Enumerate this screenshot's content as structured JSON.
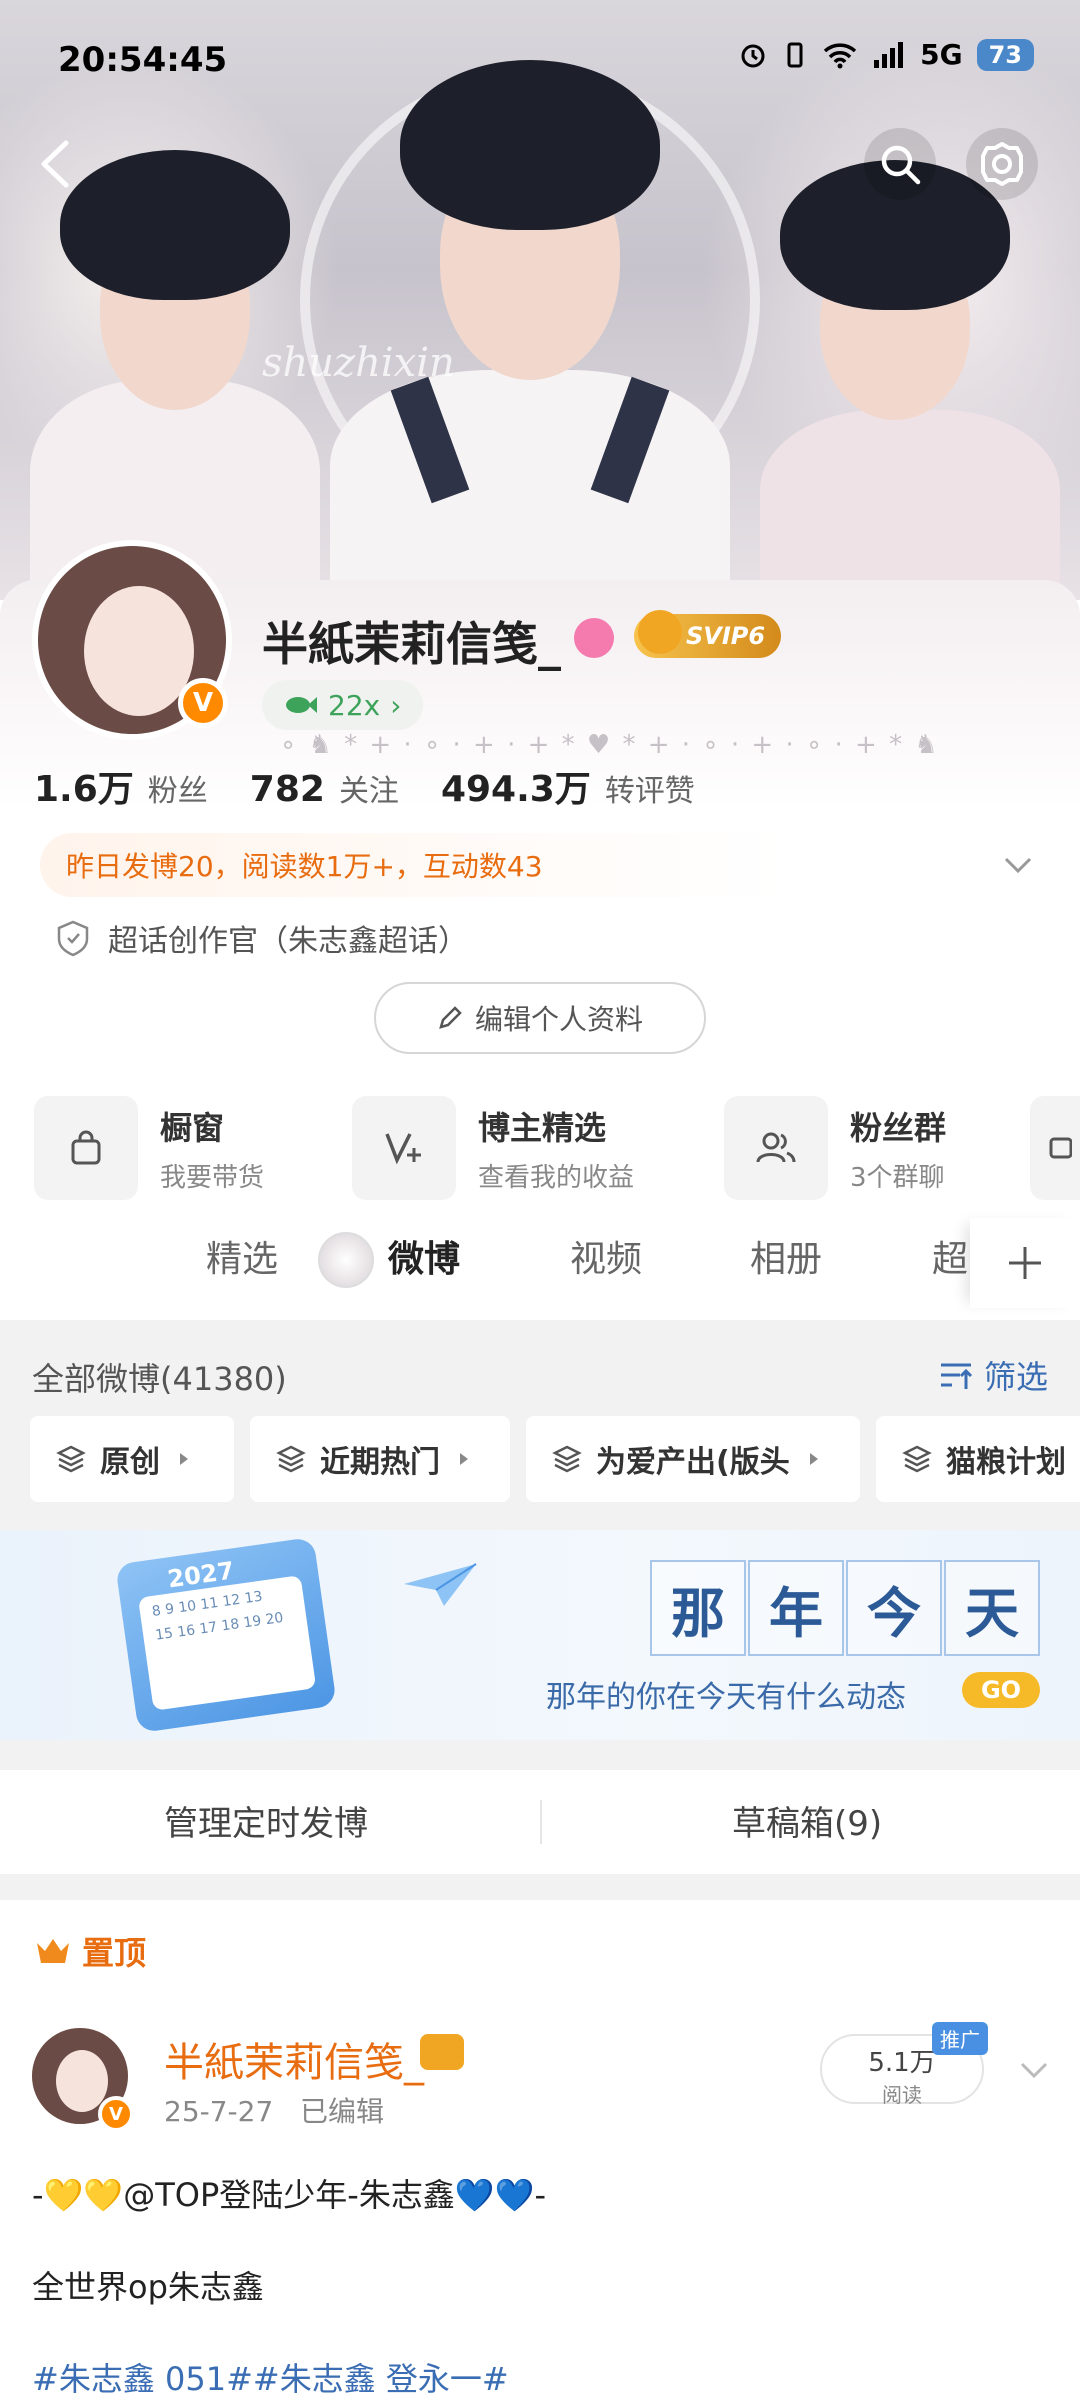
{
  "status_bar": {
    "time": "20:54:45",
    "network": "5G",
    "battery": "73"
  },
  "banner": {
    "watermark": "shuzhixin"
  },
  "profile": {
    "name": "半紙茉莉信笺_",
    "svip": "SVIP6",
    "fish_count": "22x",
    "stats": [
      {
        "value": "1.6万",
        "label": "粉丝"
      },
      {
        "value": "782",
        "label": "关注"
      },
      {
        "value": "494.3万",
        "label": "转评赞"
      }
    ],
    "yesterday": "昨日发博20，阅读数1万+，互动数43",
    "chaohua": "超话创作官（朱志鑫超话）",
    "edit_label": "编辑个人资料"
  },
  "features": [
    {
      "title": "橱窗",
      "sub": "我要带货",
      "icon": "shopping-bag-icon"
    },
    {
      "title": "博主精选",
      "sub": "查看我的收益",
      "icon": "v-plus-icon"
    },
    {
      "title": "粉丝群",
      "sub": "3个群聊",
      "icon": "group-icon"
    }
  ],
  "tabs": [
    "精选",
    "微博",
    "视频",
    "相册",
    "超"
  ],
  "weibo": {
    "all_label": "全部微博(41380)",
    "filter_label": "筛选",
    "chips": [
      "原创",
      "近期热门",
      "为爱产出(版头",
      "猫粮计划"
    ]
  },
  "promo": {
    "year": "2027",
    "title_chars": [
      "那",
      "年",
      "今",
      "天"
    ],
    "subtitle": "那年的你在今天有什么动态",
    "go": "GO"
  },
  "manage": {
    "scheduled": "管理定时发博",
    "drafts": "草稿箱(9)"
  },
  "post": {
    "pinned_label": "置顶",
    "author": "半紙茉莉信笺_",
    "date": "25-7-27",
    "edited": "已编辑",
    "reads": "5.1万",
    "reads_label": "阅读",
    "promo_tag": "推广",
    "line1": "-💛💛@TOP登陆少年-朱志鑫💙💙-",
    "line2": "全世界op朱志鑫",
    "line3": "#朱志鑫 051##朱志鑫 登永一#"
  }
}
